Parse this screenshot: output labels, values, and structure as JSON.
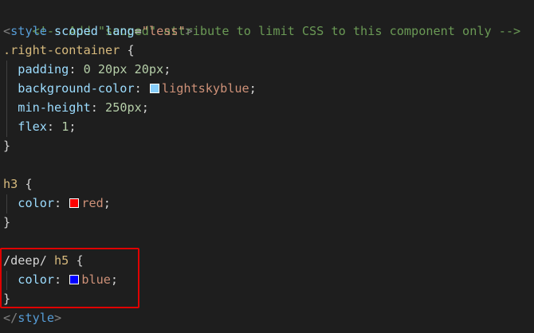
{
  "colors": {
    "background": "#1e1e1e",
    "comment": "#6a9955",
    "tag": "#569cd6",
    "attribute": "#9cdcfe",
    "string": "#ce9178",
    "selector": "#d7ba7d",
    "number": "#b5cea8",
    "highlight": "#e00000",
    "swatch_lightskyblue": "#87cefa",
    "swatch_red": "#ff0000",
    "swatch_blue": "#0000ff"
  },
  "code": {
    "comment": "<!-- Add \"scoped\" attribute to limit CSS to this component only -->",
    "style_open": "<",
    "style_tag": "style",
    "attr_scoped": "scoped",
    "attr_lang": "lang",
    "eq": "=",
    "lang_value": "\"less\"",
    "style_close_bracket": ">",
    "rc_selector": ".right-container",
    "brace_open": "{",
    "brace_close": "}",
    "padding_prop": "padding",
    "padding_val": "0 20px 20px",
    "bg_prop": "background-color",
    "bg_val": "lightskyblue",
    "minh_prop": "min-height",
    "minh_val": "250px",
    "flex_prop": "flex",
    "flex_val": "1",
    "h3_selector": "h3",
    "color_prop": "color",
    "red_val": "red",
    "deep_combinator": "/deep/",
    "h5_selector": "h5",
    "blue_val": "blue",
    "end_open": "</",
    "end_tag": "style",
    "end_close": ">",
    "colon": ":",
    "semicolon": ";"
  }
}
